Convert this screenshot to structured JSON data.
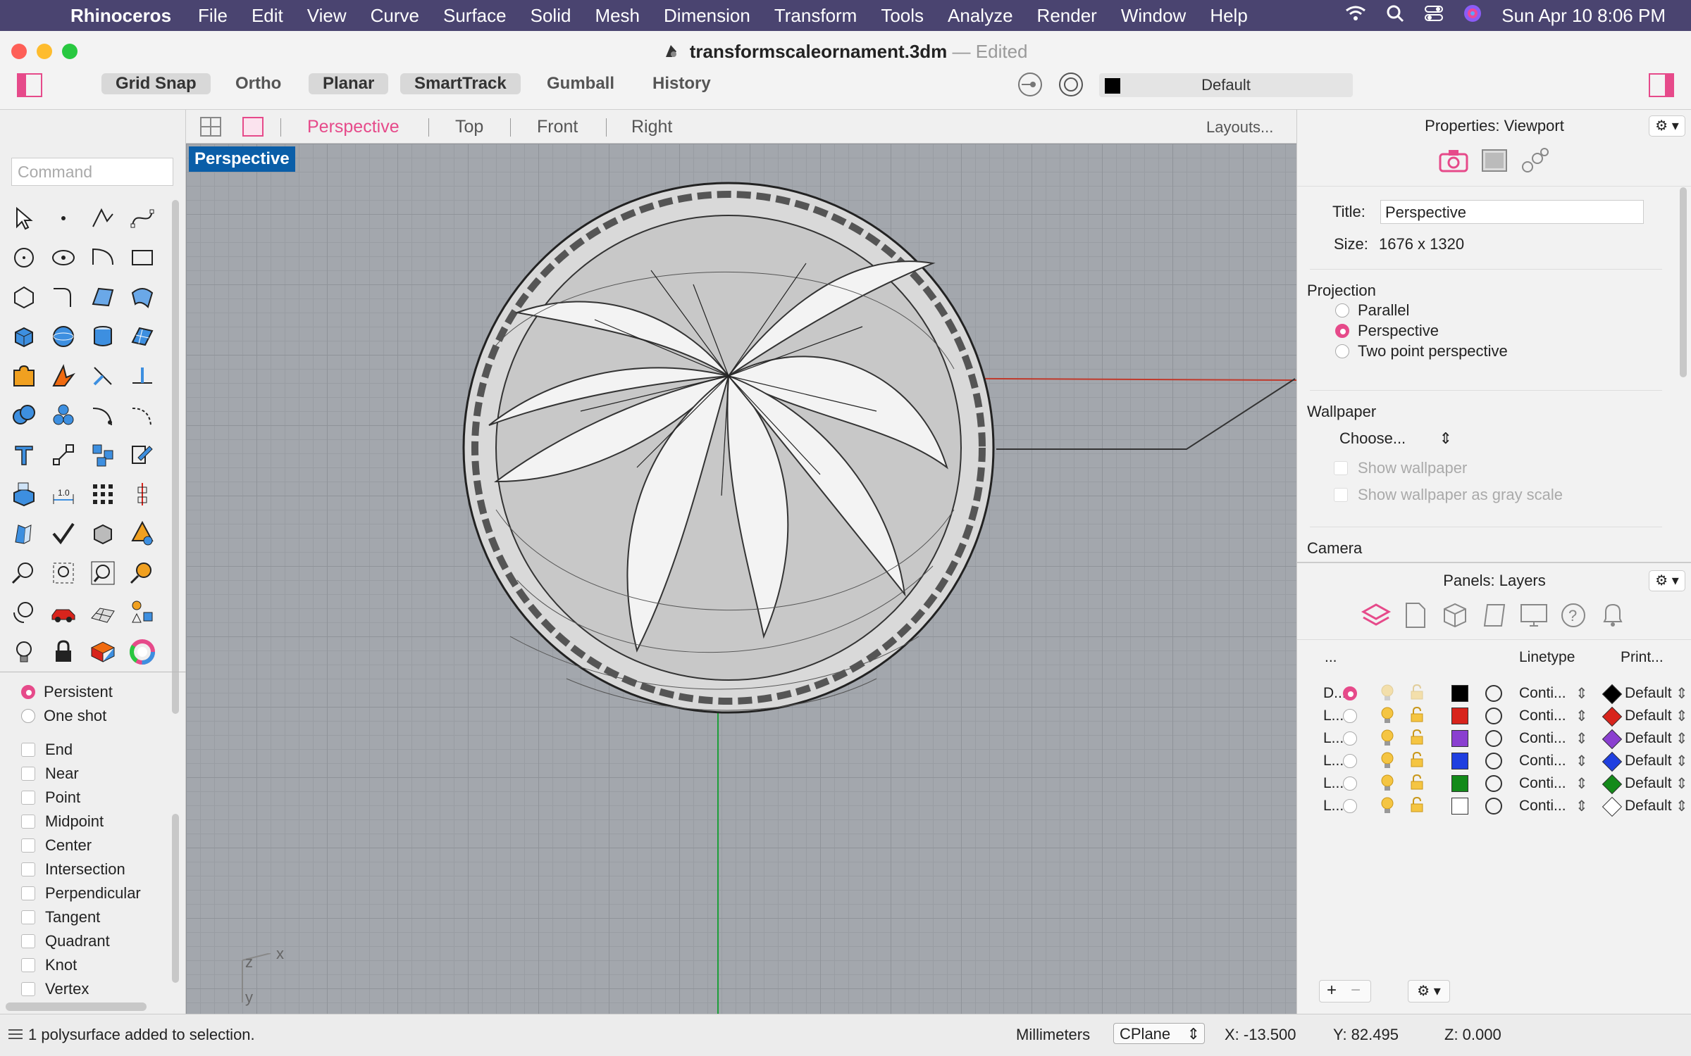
{
  "menubar": {
    "app": "Rhinoceros",
    "items": [
      "File",
      "Edit",
      "View",
      "Curve",
      "Surface",
      "Solid",
      "Mesh",
      "Dimension",
      "Transform",
      "Tools",
      "Analyze",
      "Render",
      "Window",
      "Help"
    ],
    "clock": "Sun Apr 10  8:06 PM"
  },
  "window": {
    "filename": "transformscaleornament.3dm",
    "separator": "—",
    "state": "Edited"
  },
  "toolbar": {
    "grid_snap": "Grid Snap",
    "ortho": "Ortho",
    "planar": "Planar",
    "smarttrack": "SmartTrack",
    "gumball": "Gumball",
    "history": "History",
    "layer": "Default"
  },
  "viewport_tabs": {
    "perspective": "Perspective",
    "top": "Top",
    "front": "Front",
    "right": "Right",
    "layouts": "Layouts..."
  },
  "command": {
    "placeholder": "Command"
  },
  "viewport": {
    "label": "Perspective",
    "axis_z": "z",
    "axis_x": "x",
    "axis_y": "y"
  },
  "osnap": {
    "persistent": "Persistent",
    "one_shot": "One shot",
    "items": [
      "End",
      "Near",
      "Point",
      "Midpoint",
      "Center",
      "Intersection",
      "Perpendicular",
      "Tangent",
      "Quadrant",
      "Knot",
      "Vertex"
    ]
  },
  "properties": {
    "header": "Properties: Viewport",
    "title_label": "Title:",
    "title_value": "Perspective",
    "size_label": "Size:",
    "size_value": "1676 x 1320",
    "projection_label": "Projection",
    "parallel": "Parallel",
    "perspective": "Perspective",
    "two_point": "Two point perspective",
    "wallpaper_label": "Wallpaper",
    "choose": "Choose...",
    "show_wallpaper": "Show wallpaper",
    "show_gray": "Show wallpaper as gray scale",
    "camera_label": "Camera"
  },
  "layers": {
    "header": "Panels: Layers",
    "col_name": "...",
    "col_linetype": "Linetype",
    "col_print": "Print...",
    "rows": [
      {
        "name": "D...",
        "current": true,
        "color": "#000000",
        "linetype": "Conti...",
        "print_color": "#000000",
        "print": "Default"
      },
      {
        "name": "L...",
        "current": false,
        "color": "#d8241c",
        "linetype": "Conti...",
        "print_color": "#d8241c",
        "print": "Default"
      },
      {
        "name": "L...",
        "current": false,
        "color": "#8a3fd0",
        "linetype": "Conti...",
        "print_color": "#8a3fd0",
        "print": "Default"
      },
      {
        "name": "L...",
        "current": false,
        "color": "#1f3fe0",
        "linetype": "Conti...",
        "print_color": "#1f3fe0",
        "print": "Default"
      },
      {
        "name": "L...",
        "current": false,
        "color": "#138a1a",
        "linetype": "Conti...",
        "print_color": "#138a1a",
        "print": "Default"
      },
      {
        "name": "L...",
        "current": false,
        "color": "#ffffff",
        "linetype": "Conti...",
        "print_color": "#ffffff",
        "print": "Default"
      }
    ]
  },
  "status": {
    "message": "1 polysurface added to selection.",
    "units": "Millimeters",
    "cplane": "CPlane",
    "x": "X: -13.500",
    "y": "Y: 82.495",
    "z": "Z: 0.000"
  },
  "colors": {
    "accent": "#e64a8a",
    "viewport_label": "#0a5ea8",
    "menubar": "#4a4470"
  }
}
